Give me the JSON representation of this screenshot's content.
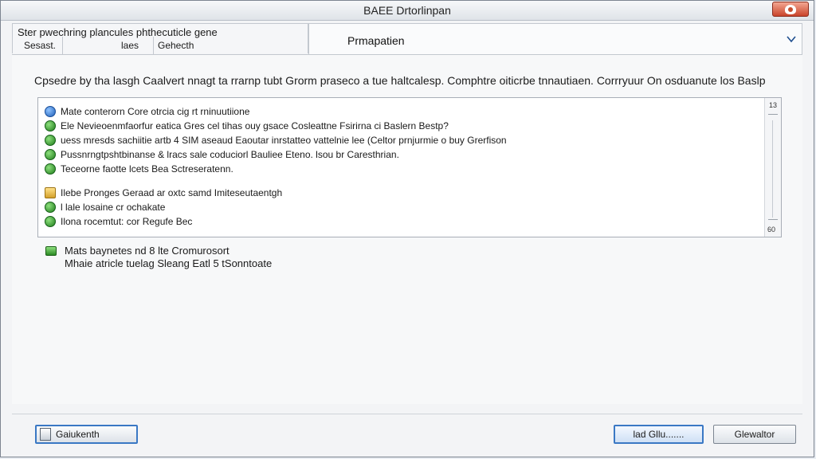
{
  "window": {
    "title": "BAEE Drtorlinpan",
    "close_label": ""
  },
  "tabs": {
    "left_line1": "Ster pwechring plancules phthecuticle gene",
    "left_line2": "Sesast.",
    "left_line3": "laes",
    "left_line4": "Gehecth",
    "active_label": "Prmapatien"
  },
  "description": "Cpsedre by tha lasgh Caalvert nnagt ta rrarnp tubt Grorm praseco a tue haltcalesp. Comphtre oiticrbe tnnautiaen. Corrryuur On osduanute los Baslp",
  "list": {
    "items": [
      {
        "icon": "globe-icon",
        "text": "Mate conterorn Core otrcia cig rt rninuutiione"
      },
      {
        "icon": "green-check-icon",
        "text": "Ele Nevieoenmfaorfur eatica Gres cel tihas ouy gsace Cosleattne Fsirirna ci Baslern Bestp?"
      },
      {
        "icon": "green-check-icon",
        "text": "uess mresds sachiitie artb 4 SIM aseaud Eaoutar inrstatteo vattelnie lee (Celtor prnjurmie o buy Grerfison"
      },
      {
        "icon": "green-circle-icon",
        "text": "Pussnrngtpshtbinanse & lracs sale coduciorl Bauliee Eteno. lsou br Caresthrian."
      },
      {
        "icon": "green-check-icon",
        "text": "Teceorne faotte lcets Bea Sctreseratenn."
      },
      {
        "icon": "lock-icon",
        "text": "Ilebe Pronges Geraad ar oxtc samd Imiteseutaentgh"
      },
      {
        "icon": "green-check-icon",
        "text": "l lale losaine cr ochakate"
      },
      {
        "icon": "green-circle-icon",
        "text": "Ilona rocemtut: cor Regufe Bec"
      }
    ],
    "scroll_top": "13",
    "scroll_bottom": "60"
  },
  "info": {
    "icon": "green-folder-icon",
    "line1": "Mats baynetes nd 8 lte Cromurosort",
    "line2": "Mhaie atricle tuelag Sleang Eatl 5 tSonntoate"
  },
  "buttons": {
    "left_label": "Gaiukenth",
    "ok_label": "lad Gllu.......",
    "cancel_label": "Glewaltor"
  }
}
